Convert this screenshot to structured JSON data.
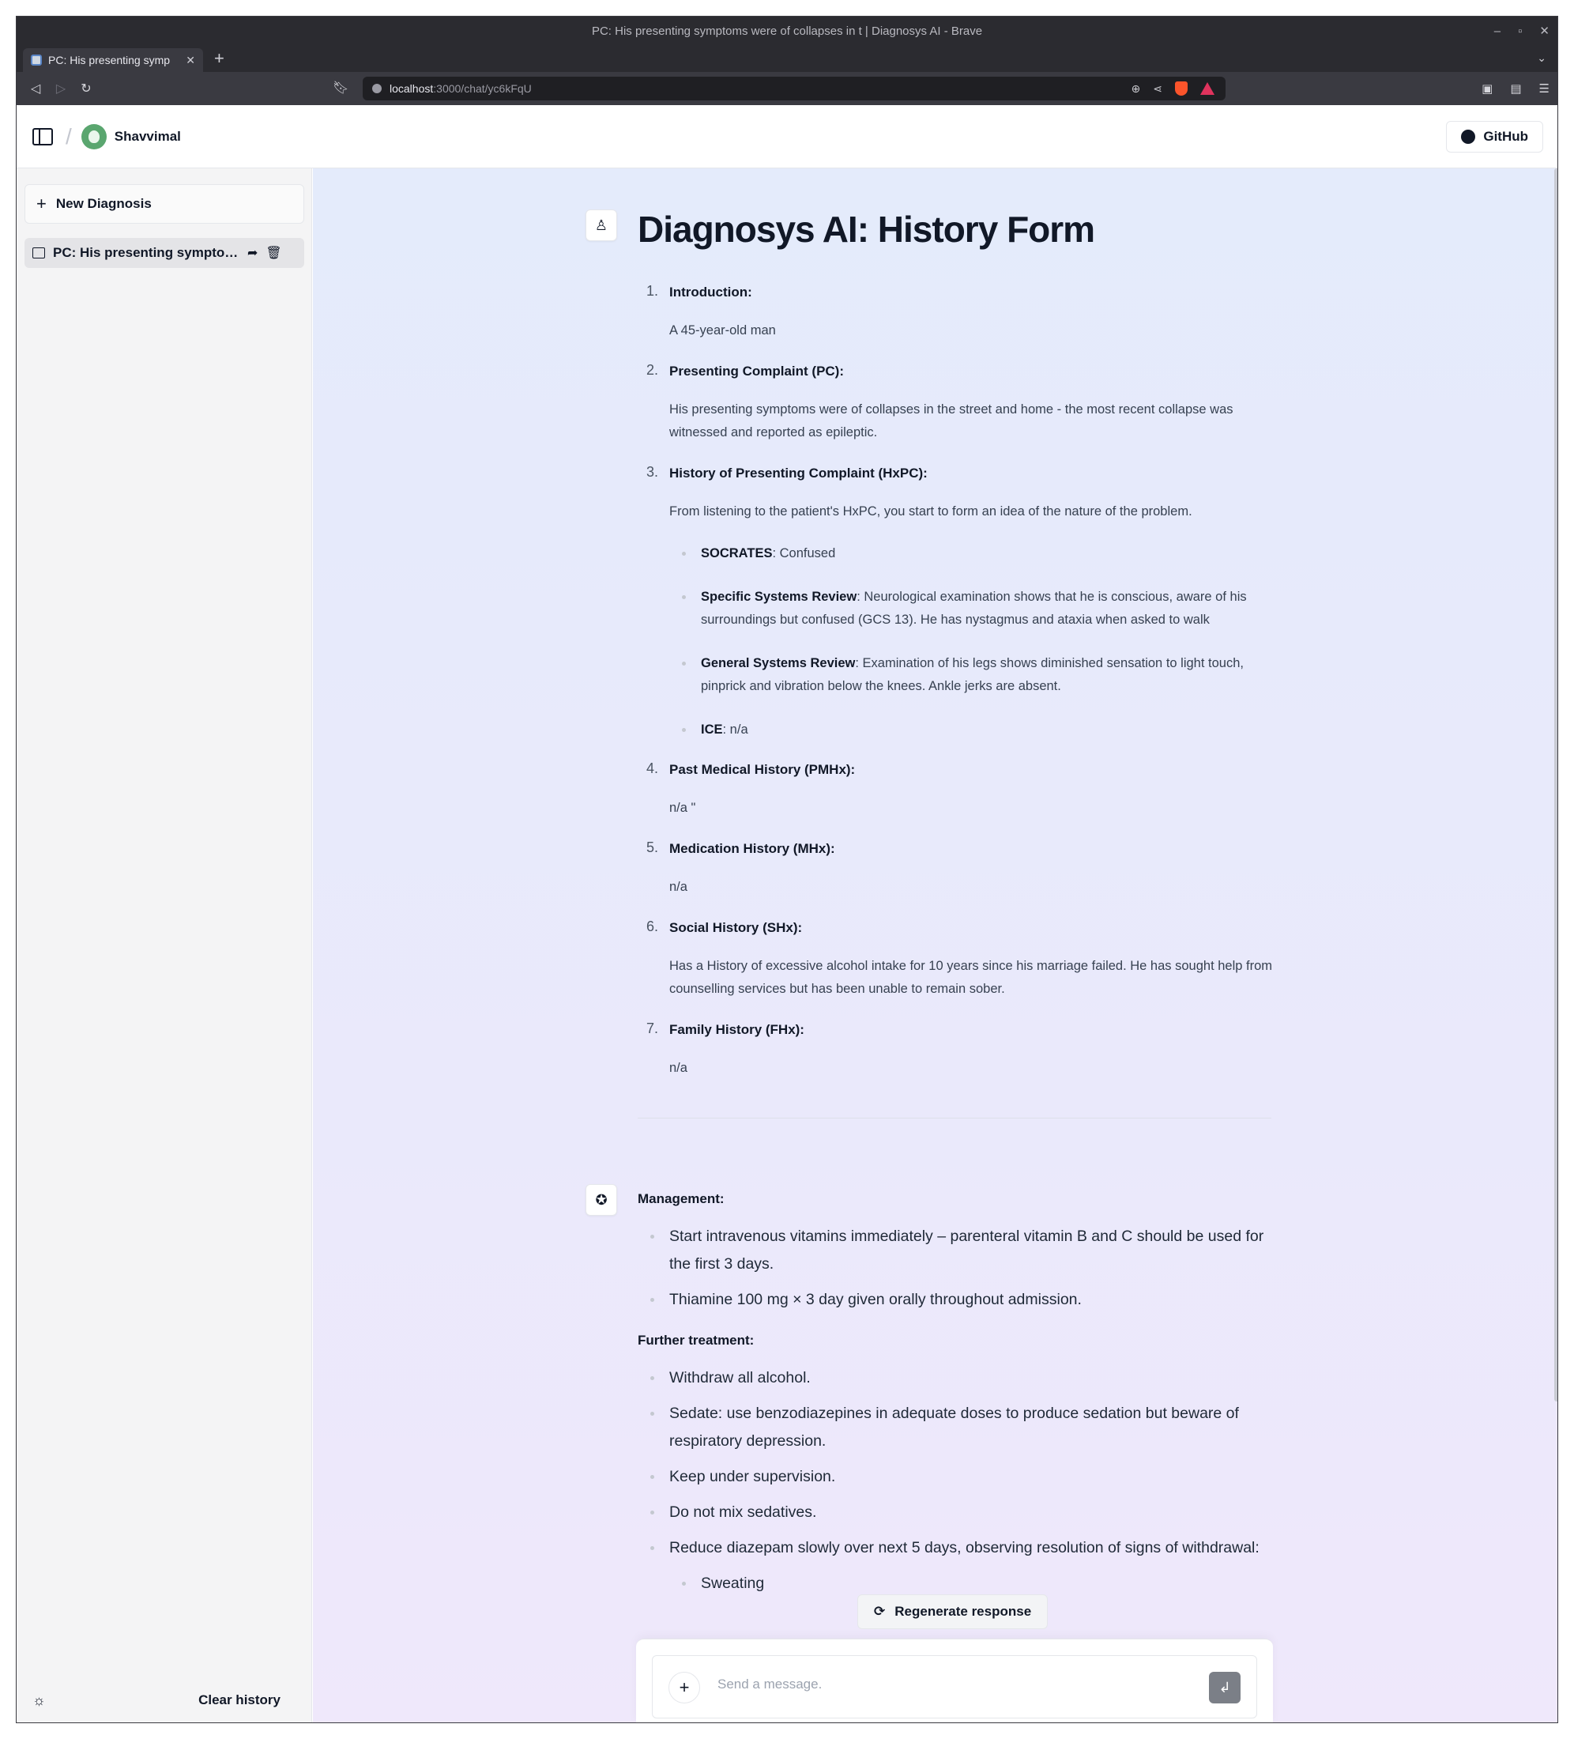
{
  "browser": {
    "window_title": "PC: His presenting symptoms were of collapses in t | Diagnosys AI - Brave",
    "tab_title": "PC: His presenting symp",
    "url_host": "localhost",
    "url_path": ":3000/chat/yc6kFqU",
    "window_controls": [
      "–",
      "▫",
      "✕"
    ]
  },
  "header": {
    "user_name": "Shavvimal",
    "github_label": "GitHub"
  },
  "sidebar": {
    "new_label": "New Diagnosis",
    "chats": [
      {
        "title": "PC: His presenting symptoms were of collapses in the street and home"
      }
    ],
    "clear_label": "Clear history"
  },
  "form": {
    "title": "Diagnosys AI: History Form",
    "sections": [
      {
        "num": "1.",
        "heading": "Introduction:",
        "text": "A 45-year-old man"
      },
      {
        "num": "2.",
        "heading": "Presenting Complaint (PC):",
        "text": "His presenting symptoms were of collapses in the street and home - the most recent collapse was witnessed and reported as epileptic."
      },
      {
        "num": "3.",
        "heading": "History of Presenting Complaint (HxPC):",
        "text": "From listening to the patient's HxPC, you start to form an idea of the nature of the problem.",
        "bullets": [
          {
            "label": "SOCRATES",
            "text": ": Confused"
          },
          {
            "label": "Specific Systems Review",
            "text": ": Neurological examination shows that he is conscious, aware of his surroundings but confused (GCS 13). He has nystagmus and ataxia when asked to walk"
          },
          {
            "label": "General Systems Review",
            "text": ": Examination of his legs shows diminished sensation to light touch, pinprick and vibration below the knees. Ankle jerks are absent."
          },
          {
            "label": "ICE",
            "text": ": n/a"
          }
        ]
      },
      {
        "num": "4.",
        "heading": "Past Medical History (PMHx):",
        "text": "n/a \""
      },
      {
        "num": "5.",
        "heading": "Medication History (MHx):",
        "text": "n/a"
      },
      {
        "num": "6.",
        "heading": "Social History (SHx):",
        "text": "Has a History of excessive alcohol intake for 10 years since his marriage failed. He has sought help from counselling services but has been unable to remain sober."
      },
      {
        "num": "7.",
        "heading": "Family History (FHx):",
        "text": "n/a"
      }
    ]
  },
  "response": {
    "management_heading": "Management:",
    "management": [
      "Start intravenous vitamins immediately – parenteral vitamin B and C should be used for the first 3 days.",
      "Thiamine 100 mg × 3 day given orally throughout admission."
    ],
    "further_heading": "Further treatment:",
    "further": [
      "Withdraw all alcohol.",
      "Sedate: use benzodiazepines in adequate doses to produce sedation but beware of respiratory depression.",
      "Keep under supervision.",
      "Do not mix sedatives.",
      "Reduce diazepam slowly over next 5 days, observing resolution of signs of withdrawal:"
    ],
    "sub": [
      "Sweating"
    ]
  },
  "composer": {
    "regenerate_label": "Regenerate response",
    "placeholder": "Send a message."
  }
}
